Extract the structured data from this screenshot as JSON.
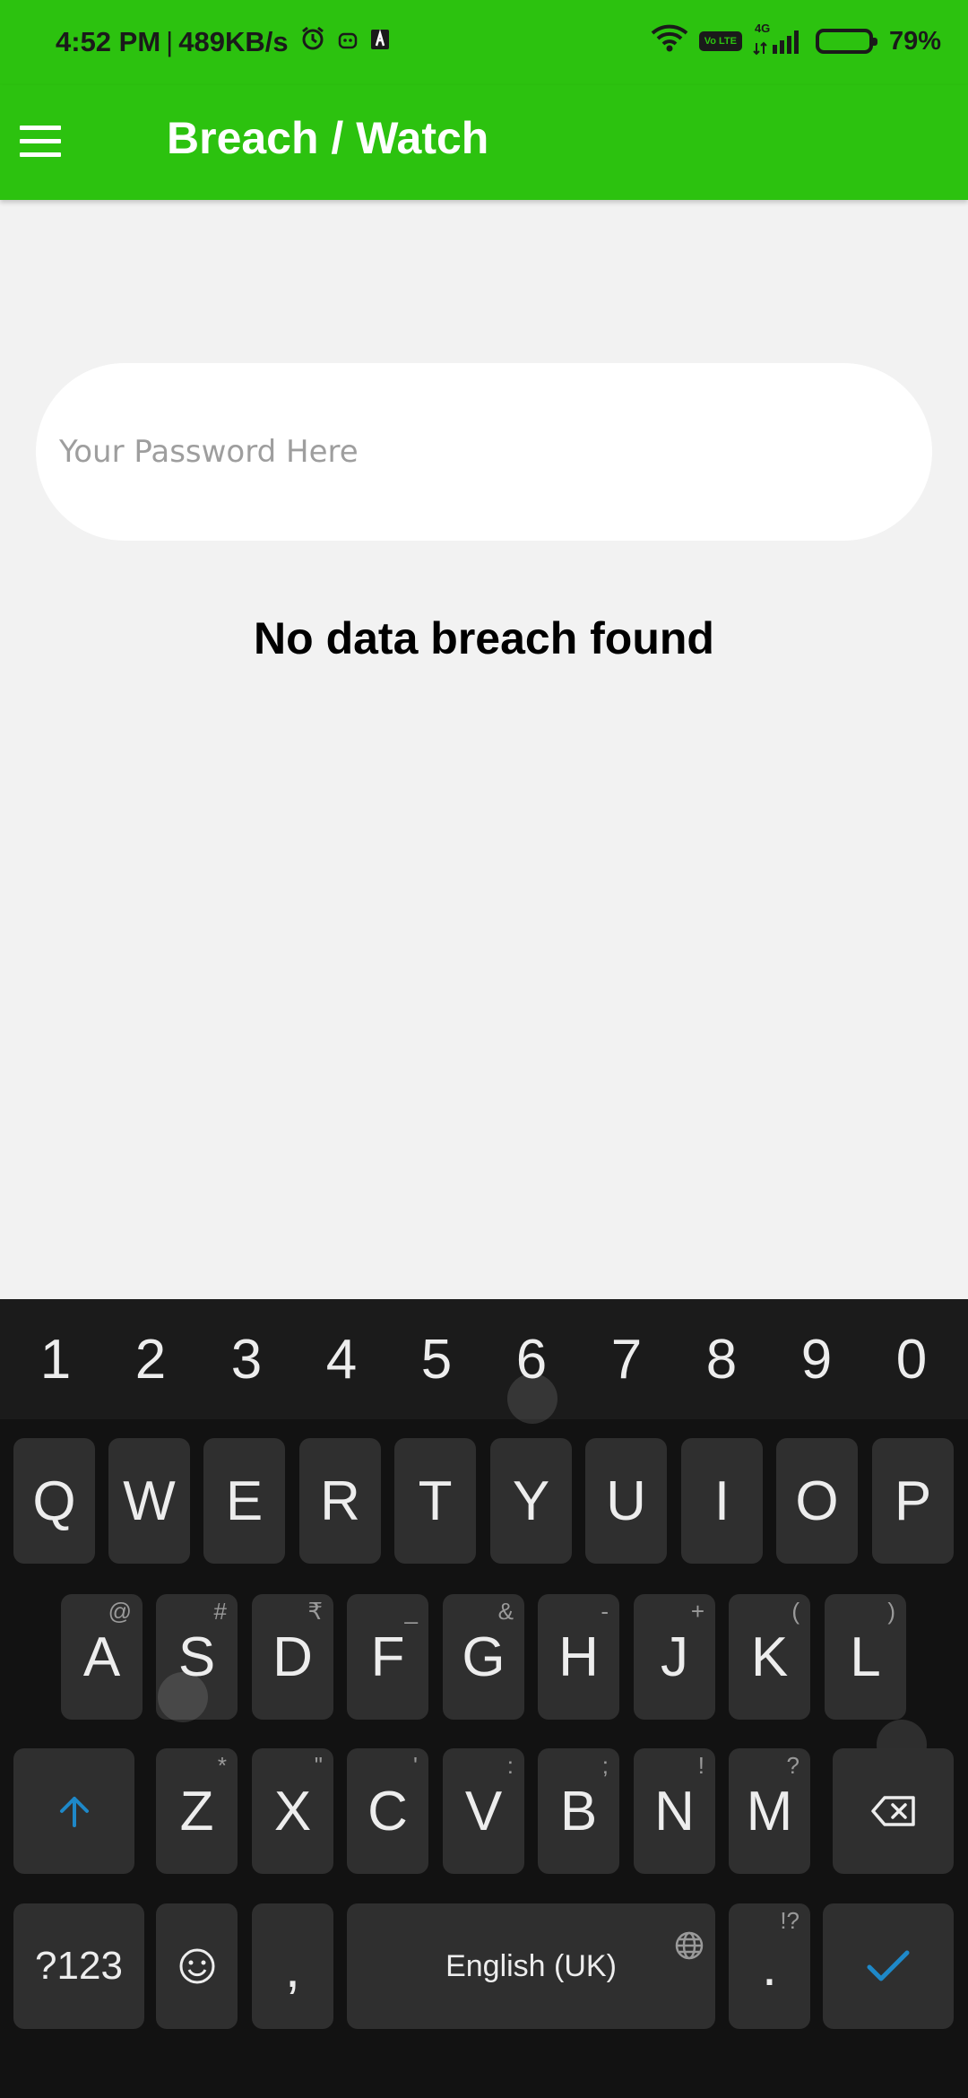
{
  "status_bar": {
    "time": "4:52 PM",
    "separator": "|",
    "speed": "489KB/s",
    "volte": "Vo LTE",
    "network": "4G",
    "battery": "79%",
    "battery_level": 0.79,
    "icons": [
      "alarm-icon",
      "notification-app-icon",
      "notification-app-icon-2",
      "wifi-icon",
      "volte-icon",
      "signal-icon",
      "battery-icon"
    ]
  },
  "app_bar": {
    "title": "Breach / Watch",
    "background": "#2cc20f",
    "menu_icon": "hamburger-menu-icon"
  },
  "main": {
    "password_placeholder": "Your Password Here",
    "password_value": "",
    "result_text": "No data breach found"
  },
  "keyboard": {
    "numbers": [
      "1",
      "2",
      "3",
      "4",
      "5",
      "6",
      "7",
      "8",
      "9",
      "0"
    ],
    "row1": [
      "Q",
      "W",
      "E",
      "R",
      "T",
      "Y",
      "U",
      "I",
      "O",
      "P"
    ],
    "row2": [
      {
        "label": "A",
        "hint": "@"
      },
      {
        "label": "S",
        "hint": "#"
      },
      {
        "label": "D",
        "hint": "₹"
      },
      {
        "label": "F",
        "hint": "_"
      },
      {
        "label": "G",
        "hint": "&"
      },
      {
        "label": "H",
        "hint": "-"
      },
      {
        "label": "J",
        "hint": "+"
      },
      {
        "label": "K",
        "hint": "("
      },
      {
        "label": "L",
        "hint": ")"
      }
    ],
    "row3": [
      {
        "label": "Z",
        "hint": "*"
      },
      {
        "label": "X",
        "hint": "\""
      },
      {
        "label": "C",
        "hint": "'"
      },
      {
        "label": "V",
        "hint": ":"
      },
      {
        "label": "B",
        "hint": ";"
      },
      {
        "label": "N",
        "hint": "!"
      },
      {
        "label": "M",
        "hint": "?"
      }
    ],
    "symbols_label": "?123",
    "comma_label": ",",
    "space_label": "English (UK)",
    "period_label": ".",
    "period_hint": "!?",
    "accent_color": "#1e88c8"
  }
}
